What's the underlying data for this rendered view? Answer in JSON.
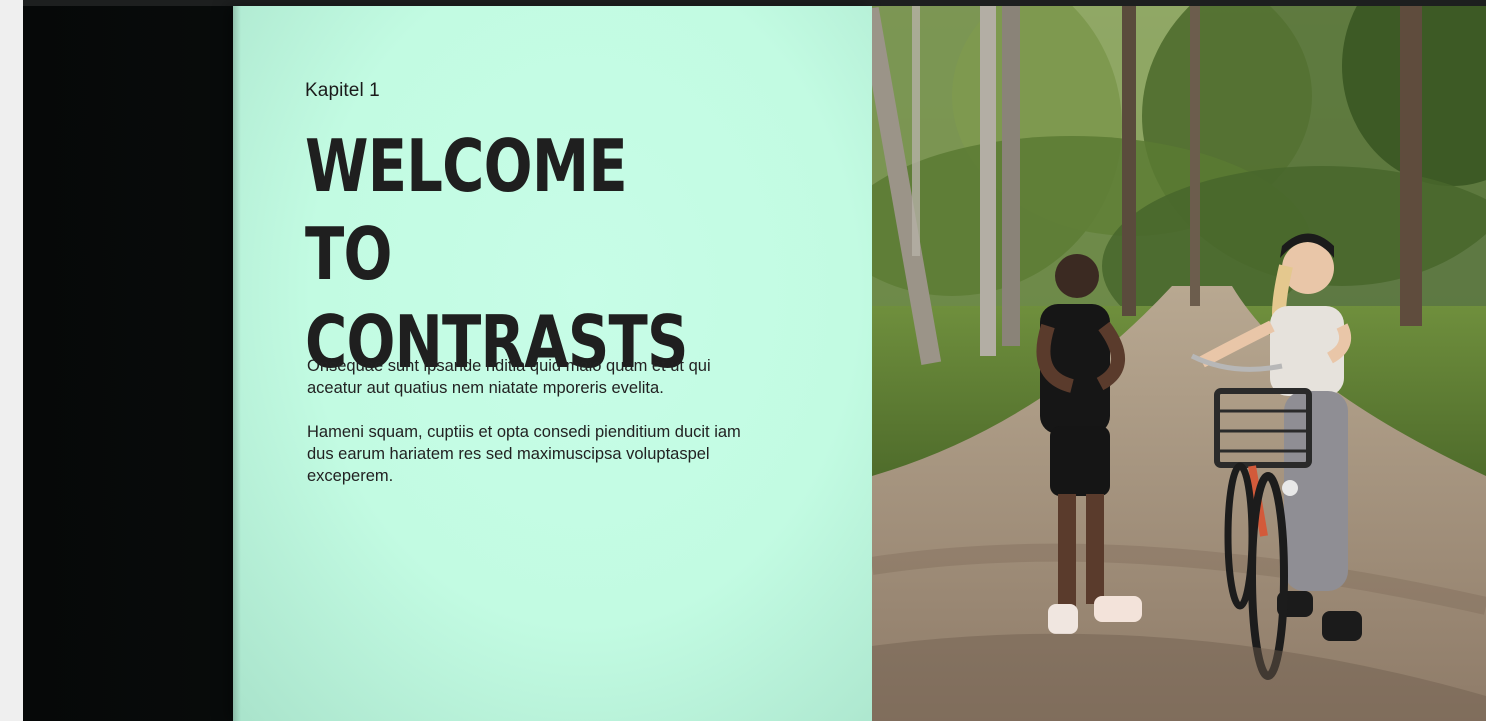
{
  "slide": {
    "chapter": "Kapitel 1",
    "title_line1": "WELCOME TO",
    "title_line2": "CONTRASTS",
    "paragraph1": "Onsequae sunt ipsande nditia quid maio quam et ut qui aceatur aut quatius nem niatate mporeris evelita.",
    "paragraph2": "Hameni squam, cuptiis et opta consedi pienditium ducit iam dus earum hariatem res sed maximuscipsa voluptaspel exceperem."
  },
  "colors": {
    "slide_background": "#c4fce4",
    "text": "#1f1f1f",
    "frame": "#0a0e0d"
  },
  "photo": {
    "icon": "forest-path-cyclists-photo"
  }
}
